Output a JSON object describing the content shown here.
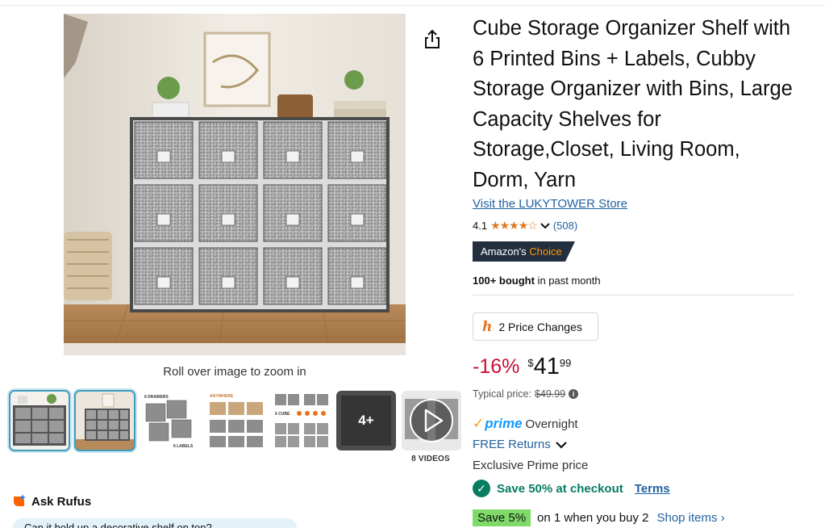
{
  "product": {
    "title": "Cube Storage Organizer Shelf with 6 Printed Bins + Labels, Cubby Storage Organizer with Bins, Large Capacity Shelves for Storage,Closet, Living Room, Dorm, Yarn",
    "store_link": "Visit the LUKYTOWER Store",
    "rating_value": "4.1",
    "rating_stars": "★★★★☆",
    "rating_count": "(508)",
    "badge_prefix": "Amazon's ",
    "badge_suffix": "Choice",
    "bought_bold": "100+ bought",
    "bought_rest": " in past month"
  },
  "gallery": {
    "zoom_hint": "Roll over image to zoom in",
    "more_count": "4+",
    "videos_label": "8 VIDEOS",
    "thumbnails": [
      "thumb-1",
      "thumb-2",
      "thumb-3",
      "thumb-4",
      "thumb-5",
      "thumb-6",
      "thumb-7"
    ],
    "selected_index": 1
  },
  "pricing": {
    "price_changes_label": "2 Price Changes",
    "discount": "-16%",
    "currency": "$",
    "whole": "41",
    "fraction": "99",
    "typical_label": "Typical price: ",
    "typical_value": "$49.99",
    "info_icon": "i"
  },
  "delivery": {
    "prime_check": "✓",
    "prime_label": "prime",
    "prime_speed": "Overnight",
    "free_returns": "FREE Returns",
    "exclusive": "Exclusive Prime price",
    "save_checkout": "Save 50% at checkout",
    "terms": "Terms",
    "coupon_badge": "Save 5%",
    "coupon_text": "on 1 when you buy 2",
    "shop_items": "Shop items ›"
  },
  "rufus": {
    "label": "Ask Rufus",
    "question": "Can it hold up a decorative shelf on top?"
  },
  "colors": {
    "link": "#2162a1",
    "discount": "#cc0c39",
    "prime": "#1399ff",
    "success": "#067d62",
    "coupon": "#7fda69",
    "badge_bg": "#232f3e",
    "badge_accent": "#ff9900",
    "star": "#de7921"
  },
  "icons": [
    "share-icon",
    "star-icon",
    "chevron-down-icon",
    "info-icon",
    "check-circle-icon",
    "play-icon",
    "rufus-icon",
    "price-history-icon"
  ]
}
